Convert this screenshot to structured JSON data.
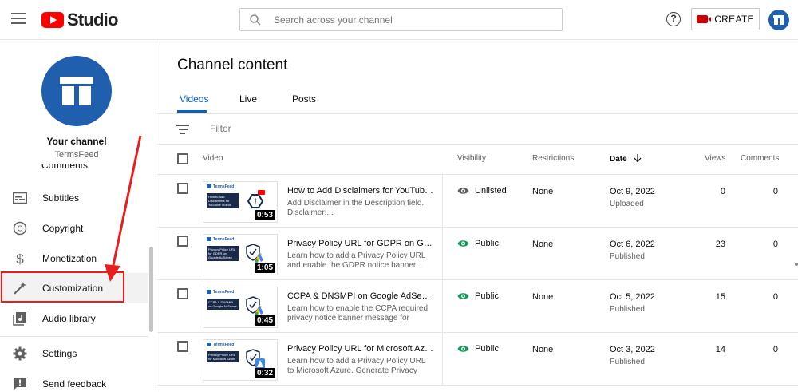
{
  "header": {
    "logo_text": "Studio",
    "search_placeholder": "Search across your channel",
    "help_glyph": "?",
    "create_label": "CREATE"
  },
  "sidebar": {
    "channel_title": "Your channel",
    "channel_name": "TermsFeed",
    "partial_item": "Comments",
    "items": [
      {
        "label": "Subtitles",
        "icon": "subtitles-icon"
      },
      {
        "label": "Copyright",
        "icon": "copyright-icon"
      },
      {
        "label": "Monetization",
        "icon": "dollar-icon"
      },
      {
        "label": "Customization",
        "icon": "magic-wand-icon"
      },
      {
        "label": "Audio library",
        "icon": "audio-library-icon"
      },
      {
        "label": "Settings",
        "icon": "gear-icon"
      },
      {
        "label": "Send feedback",
        "icon": "feedback-icon"
      }
    ]
  },
  "main": {
    "title": "Channel content",
    "tabs": [
      "Videos",
      "Live",
      "Posts"
    ],
    "filter_placeholder": "Filter",
    "columns": {
      "video": "Video",
      "visibility": "Visibility",
      "restrictions": "Restrictions",
      "date": "Date",
      "views": "Views",
      "comments": "Comments"
    },
    "rows": [
      {
        "title": "How to Add Disclaimers for YouTube ...",
        "desc": "Add Disclaimer in the Description field. Disclaimer:...",
        "duration": "0:53",
        "thumb_caption": "How to Add Disclaimers for YouTube Videos",
        "thumb_brand": "TermsFeed",
        "visibility": "Unlisted",
        "restrictions": "None",
        "date": "Oct 9, 2022",
        "date_status": "Uploaded",
        "views": "0",
        "comments": "0"
      },
      {
        "title": "Privacy Policy URL for GDPR on Googl...",
        "desc": "Learn how to add a Privacy Policy URL and enable the GDPR notice banner...",
        "duration": "1:05",
        "thumb_caption": "Privacy Policy URL for GDPR on Google AdSense",
        "thumb_brand": "TermsFeed",
        "visibility": "Public",
        "restrictions": "None",
        "date": "Oct 6, 2022",
        "date_status": "Published",
        "views": "23",
        "comments": "0"
      },
      {
        "title": "CCPA & DNSMPI on Google AdSense",
        "desc": "Learn how to enable the CCPA required privacy notice banner message for Goog...",
        "duration": "0:45",
        "thumb_caption": "CCPA & DNSMPI on Google AdSense",
        "thumb_brand": "TermsFeed",
        "visibility": "Public",
        "restrictions": "None",
        "date": "Oct 5, 2022",
        "date_status": "Published",
        "views": "15",
        "comments": "0"
      },
      {
        "title": "Privacy Policy URL for Microsoft Azure",
        "desc": "Learn how to add a Privacy Policy URL to Microsoft Azure. Generate Privacy Policy...",
        "duration": "0:32",
        "thumb_caption": "Privacy Policy URL for Microsoft Azure",
        "thumb_brand": "TermsFeed",
        "visibility": "Public",
        "restrictions": "None",
        "date": "Oct 3, 2022",
        "date_status": "Published",
        "views": "14",
        "comments": "0"
      }
    ]
  },
  "colors": {
    "brand_red": "#ff0000",
    "accent_blue": "#065fd4",
    "avatar_blue": "#1f5fae",
    "public_green": "#0f9d58",
    "annotation_red": "#e81d1d"
  }
}
